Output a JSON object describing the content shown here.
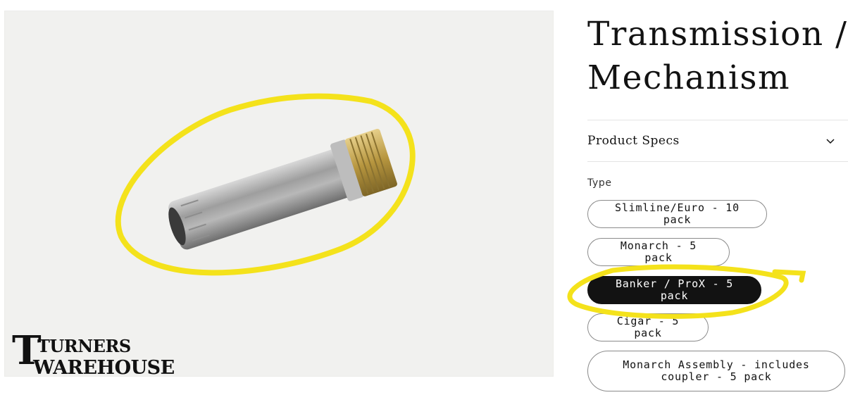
{
  "product": {
    "title": "Transmission / Mechanism",
    "specs_label": "Product Specs",
    "option_label": "Type",
    "options": [
      {
        "label": "Slimline/Euro - 10 pack",
        "selected": false
      },
      {
        "label": "Monarch - 5 pack",
        "selected": false
      },
      {
        "label": "Banker / ProX - 5 pack",
        "selected": true
      },
      {
        "label": "Cigar - 5 pack",
        "selected": false
      },
      {
        "label": "Monarch Assembly - includes coupler - 5 pack",
        "selected": false
      }
    ]
  },
  "logo": {
    "line1": "TURNERS",
    "line2": "WAREHOUSE"
  },
  "icons": {
    "specs_toggle": "chevron-down-icon"
  },
  "colors": {
    "highlight": "#f4e21b",
    "selected_bg": "#121212"
  }
}
